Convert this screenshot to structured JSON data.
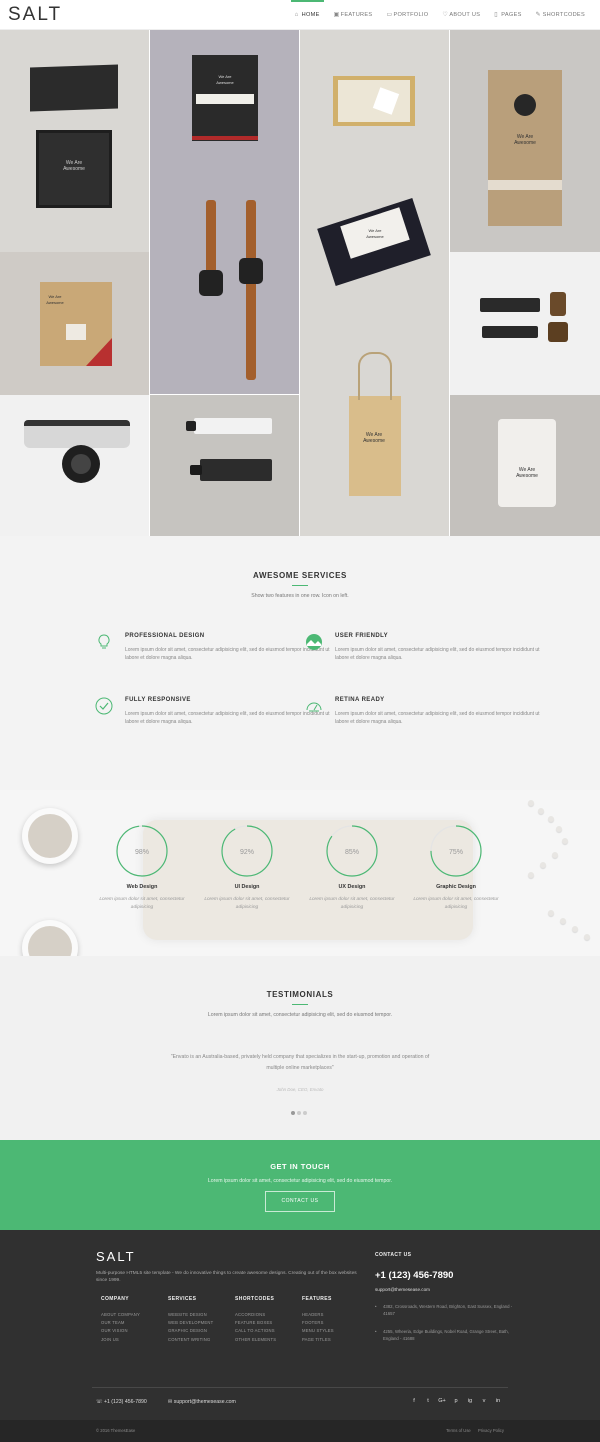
{
  "brand": "SALT",
  "colors": {
    "accent": "#4cb874",
    "footer_bg": "#303030"
  },
  "nav": {
    "items": [
      {
        "label": "HOME",
        "icon": "home-icon",
        "active": true
      },
      {
        "label": "FEATURES",
        "icon": "gift-icon"
      },
      {
        "label": "PORTFOLIO",
        "icon": "folder-icon"
      },
      {
        "label": "ABOUT US",
        "icon": "heart-icon"
      },
      {
        "label": "PAGES",
        "icon": "page-icon"
      },
      {
        "label": "SHORTCODES",
        "icon": "wrench-icon"
      }
    ]
  },
  "portfolio": {
    "labels": {
      "box": "We Are\nAwesome",
      "card": "We Are\nAwesome",
      "bag_small": "We Are\nAwesome",
      "envelope": "We Are\nAwesome",
      "paper_bag": "We Are\nAwesome",
      "pouch": "We Are\nAwesome"
    }
  },
  "services": {
    "title": "AWESOME SERVICES",
    "subtitle": "Show two features in one row. Icon on left.",
    "features": [
      {
        "title": "PROFESSIONAL DESIGN",
        "icon": "lightbulb-icon",
        "text": "Lorem ipsum dolor sit amet, consectetur adipisicing elit, sed do eiusmod tempor incididunt ut labore et dolore magna aliqua."
      },
      {
        "title": "USER FRIENDLY",
        "icon": "landscape-icon",
        "text": "Lorem ipsum dolor sit amet, consectetur adipisicing elit, sed do eiusmod tempor incididunt ut labore et dolore magna aliqua."
      },
      {
        "title": "FULLY RESPONSIVE",
        "icon": "check-circle-icon",
        "text": "Lorem ipsum dolor sit amet, consectetur adipisicing elit, sed do eiusmod tempor incididunt ut labore et dolore magna aliqua."
      },
      {
        "title": "RETINA READY",
        "icon": "gauge-icon",
        "text": "Lorem ipsum dolor sit amet, consectetur adipisicing elit, sed do eiusmod tempor incididunt ut labore et dolore magna aliqua."
      }
    ]
  },
  "skills": [
    {
      "value": 98,
      "label": "98%",
      "name": "Web Design",
      "desc": "Lorem ipsum dolor sit amet, consectetur adipisicing"
    },
    {
      "value": 92,
      "label": "92%",
      "name": "UI Design",
      "desc": "Lorem ipsum dolor sit amet, consectetur adipisicing"
    },
    {
      "value": 85,
      "label": "85%",
      "name": "UX Design",
      "desc": "Lorem ipsum dolor sit amet, consectetur adipisicing"
    },
    {
      "value": 75,
      "label": "75%",
      "name": "Graphic Design",
      "desc": "Lorem ipsum dolor sit amet, consectetur adipisicing"
    }
  ],
  "testimonials": {
    "title": "TESTIMONIALS",
    "subtitle": "Lorem ipsum dolor sit amet, consectetur adipisicing elit, sed do eiusmod tempor.",
    "quote": "\"Envato is an Australia-based, privately held company that specializes in the start-up, promotion and operation of multiple online marketplaces\"",
    "author": "John Doe, CEO, Envato",
    "slides": 3,
    "active_slide": 1
  },
  "touch": {
    "title": "GET IN TOUCH",
    "text": "Lorem ipsum dolor sit amet, consectetur adipisicing elit, sed do eiusmod tempor.",
    "button": "CONTACT US"
  },
  "footer": {
    "logo": "SALT",
    "about": "Multi-purpose HTML5 site template - We do innovative things to create awesome designs. Creating out of the box websites since 1999.",
    "columns": [
      {
        "title": "COMPANY",
        "links": [
          "ABOUT COMPANY",
          "OUR TEAM",
          "OUR VISION",
          "JOIN US"
        ]
      },
      {
        "title": "SERVICES",
        "links": [
          "WEBSITE DESIGN",
          "WEB DEVELOPMENT",
          "GRAPHIC DESIGN",
          "CONTENT WRITING"
        ]
      },
      {
        "title": "SHORTCODES",
        "links": [
          "ACCORDIONS",
          "FEATURE BOXES",
          "CALL TO ACTIONS",
          "OTHER ELEMENTS"
        ]
      },
      {
        "title": "FEATURES",
        "links": [
          "HEADERS",
          "FOOTERS",
          "MENU STYLES",
          "PAGE TITLES"
        ]
      }
    ],
    "contact": {
      "title": "CONTACT US",
      "phone": "+1 (123) 456-7890",
      "email": "support@themesease.com",
      "addresses": [
        "4382, Crossroads, Western Road, Brighton, East Sussex, England - 41657",
        "4255, Wheeria, Edge Buildings, Nobel Road, Grange Street, Bath, England - 41688"
      ]
    },
    "bottom_phone": "+1 (123) 456-7890",
    "bottom_email": "support@themesease.com",
    "social": [
      "f",
      "t",
      "G+",
      "p",
      "ig",
      "v",
      "in"
    ],
    "social_icons": [
      "facebook-icon",
      "twitter-icon",
      "google-plus-icon",
      "pinterest-icon",
      "instagram-icon",
      "vimeo-icon",
      "linkedin-icon"
    ],
    "copyright": "© 2016 ThemesEase",
    "legal": [
      "Terms of Use",
      "Privacy Policy"
    ]
  }
}
